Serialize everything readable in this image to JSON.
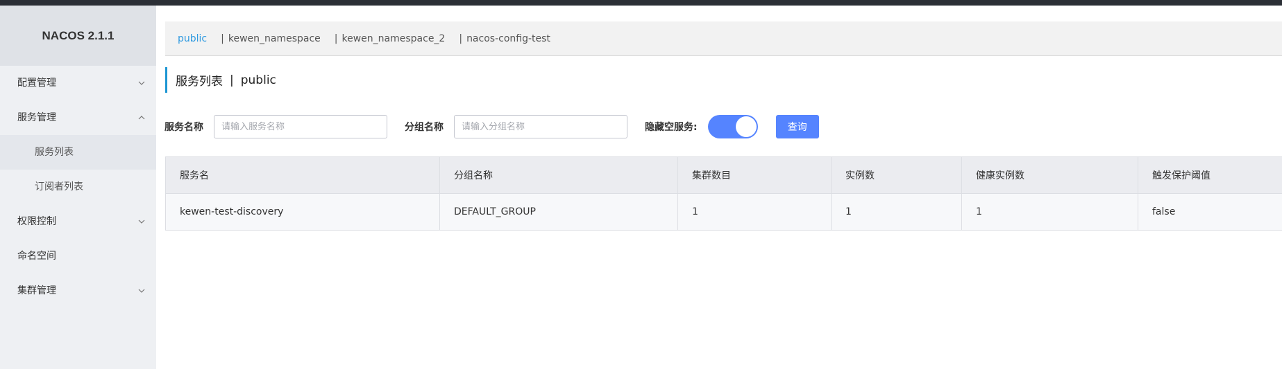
{
  "brand": {
    "title": "NACOS 2.1.1"
  },
  "sidebar": {
    "items": [
      {
        "label": "配置管理",
        "chevron": "down"
      },
      {
        "label": "服务管理",
        "chevron": "up"
      },
      {
        "label": "服务列表",
        "sub": true,
        "active": true
      },
      {
        "label": "订阅者列表",
        "sub": true
      },
      {
        "label": "权限控制",
        "chevron": "down"
      },
      {
        "label": "命名空间"
      },
      {
        "label": "集群管理",
        "chevron": "down"
      }
    ]
  },
  "namespaces": {
    "items": [
      "public",
      "kewen_namespace",
      "kewen_namespace_2",
      "nacos-config-test"
    ],
    "active": "public",
    "separator": "|"
  },
  "page": {
    "title": "服务列表",
    "separator": "|",
    "namespace": "public"
  },
  "filters": {
    "service_name_label": "服务名称",
    "service_name_placeholder": "请输入服务名称",
    "service_name_value": "",
    "group_name_label": "分组名称",
    "group_name_placeholder": "请输入分组名称",
    "group_name_value": "",
    "hide_empty_label": "隐藏空服务:",
    "hide_empty_on": true,
    "query_button": "查询"
  },
  "table": {
    "headers": [
      "服务名",
      "分组名称",
      "集群数目",
      "实例数",
      "健康实例数",
      "触发保护阈值"
    ],
    "rows": [
      [
        "kewen-test-discovery",
        "DEFAULT_GROUP",
        "1",
        "1",
        "1",
        "false"
      ]
    ]
  },
  "colors": {
    "accent": "#5584ff",
    "link_active": "#2f9ae0",
    "title_bar": "#1c96d3",
    "topbar": "#2b2f36",
    "sidebar_bg": "#eef0f3"
  }
}
